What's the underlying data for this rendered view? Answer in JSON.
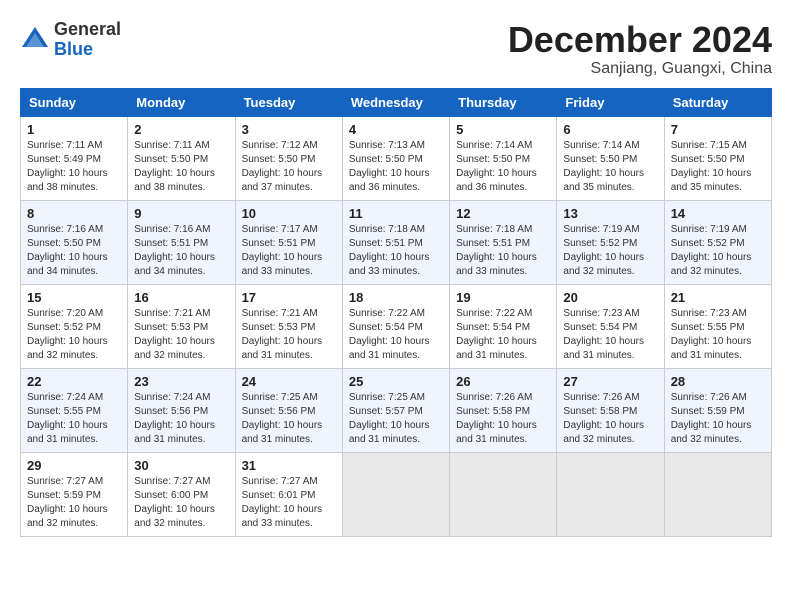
{
  "header": {
    "logo_general": "General",
    "logo_blue": "Blue",
    "month_year": "December 2024",
    "location": "Sanjiang, Guangxi, China"
  },
  "days_of_week": [
    "Sunday",
    "Monday",
    "Tuesday",
    "Wednesday",
    "Thursday",
    "Friday",
    "Saturday"
  ],
  "weeks": [
    [
      {
        "day": "1",
        "detail": "Sunrise: 7:11 AM\nSunset: 5:49 PM\nDaylight: 10 hours\nand 38 minutes."
      },
      {
        "day": "2",
        "detail": "Sunrise: 7:11 AM\nSunset: 5:50 PM\nDaylight: 10 hours\nand 38 minutes."
      },
      {
        "day": "3",
        "detail": "Sunrise: 7:12 AM\nSunset: 5:50 PM\nDaylight: 10 hours\nand 37 minutes."
      },
      {
        "day": "4",
        "detail": "Sunrise: 7:13 AM\nSunset: 5:50 PM\nDaylight: 10 hours\nand 36 minutes."
      },
      {
        "day": "5",
        "detail": "Sunrise: 7:14 AM\nSunset: 5:50 PM\nDaylight: 10 hours\nand 36 minutes."
      },
      {
        "day": "6",
        "detail": "Sunrise: 7:14 AM\nSunset: 5:50 PM\nDaylight: 10 hours\nand 35 minutes."
      },
      {
        "day": "7",
        "detail": "Sunrise: 7:15 AM\nSunset: 5:50 PM\nDaylight: 10 hours\nand 35 minutes."
      }
    ],
    [
      {
        "day": "8",
        "detail": "Sunrise: 7:16 AM\nSunset: 5:50 PM\nDaylight: 10 hours\nand 34 minutes."
      },
      {
        "day": "9",
        "detail": "Sunrise: 7:16 AM\nSunset: 5:51 PM\nDaylight: 10 hours\nand 34 minutes."
      },
      {
        "day": "10",
        "detail": "Sunrise: 7:17 AM\nSunset: 5:51 PM\nDaylight: 10 hours\nand 33 minutes."
      },
      {
        "day": "11",
        "detail": "Sunrise: 7:18 AM\nSunset: 5:51 PM\nDaylight: 10 hours\nand 33 minutes."
      },
      {
        "day": "12",
        "detail": "Sunrise: 7:18 AM\nSunset: 5:51 PM\nDaylight: 10 hours\nand 33 minutes."
      },
      {
        "day": "13",
        "detail": "Sunrise: 7:19 AM\nSunset: 5:52 PM\nDaylight: 10 hours\nand 32 minutes."
      },
      {
        "day": "14",
        "detail": "Sunrise: 7:19 AM\nSunset: 5:52 PM\nDaylight: 10 hours\nand 32 minutes."
      }
    ],
    [
      {
        "day": "15",
        "detail": "Sunrise: 7:20 AM\nSunset: 5:52 PM\nDaylight: 10 hours\nand 32 minutes."
      },
      {
        "day": "16",
        "detail": "Sunrise: 7:21 AM\nSunset: 5:53 PM\nDaylight: 10 hours\nand 32 minutes."
      },
      {
        "day": "17",
        "detail": "Sunrise: 7:21 AM\nSunset: 5:53 PM\nDaylight: 10 hours\nand 31 minutes."
      },
      {
        "day": "18",
        "detail": "Sunrise: 7:22 AM\nSunset: 5:54 PM\nDaylight: 10 hours\nand 31 minutes."
      },
      {
        "day": "19",
        "detail": "Sunrise: 7:22 AM\nSunset: 5:54 PM\nDaylight: 10 hours\nand 31 minutes."
      },
      {
        "day": "20",
        "detail": "Sunrise: 7:23 AM\nSunset: 5:54 PM\nDaylight: 10 hours\nand 31 minutes."
      },
      {
        "day": "21",
        "detail": "Sunrise: 7:23 AM\nSunset: 5:55 PM\nDaylight: 10 hours\nand 31 minutes."
      }
    ],
    [
      {
        "day": "22",
        "detail": "Sunrise: 7:24 AM\nSunset: 5:55 PM\nDaylight: 10 hours\nand 31 minutes."
      },
      {
        "day": "23",
        "detail": "Sunrise: 7:24 AM\nSunset: 5:56 PM\nDaylight: 10 hours\nand 31 minutes."
      },
      {
        "day": "24",
        "detail": "Sunrise: 7:25 AM\nSunset: 5:56 PM\nDaylight: 10 hours\nand 31 minutes."
      },
      {
        "day": "25",
        "detail": "Sunrise: 7:25 AM\nSunset: 5:57 PM\nDaylight: 10 hours\nand 31 minutes."
      },
      {
        "day": "26",
        "detail": "Sunrise: 7:26 AM\nSunset: 5:58 PM\nDaylight: 10 hours\nand 31 minutes."
      },
      {
        "day": "27",
        "detail": "Sunrise: 7:26 AM\nSunset: 5:58 PM\nDaylight: 10 hours\nand 32 minutes."
      },
      {
        "day": "28",
        "detail": "Sunrise: 7:26 AM\nSunset: 5:59 PM\nDaylight: 10 hours\nand 32 minutes."
      }
    ],
    [
      {
        "day": "29",
        "detail": "Sunrise: 7:27 AM\nSunset: 5:59 PM\nDaylight: 10 hours\nand 32 minutes."
      },
      {
        "day": "30",
        "detail": "Sunrise: 7:27 AM\nSunset: 6:00 PM\nDaylight: 10 hours\nand 32 minutes."
      },
      {
        "day": "31",
        "detail": "Sunrise: 7:27 AM\nSunset: 6:01 PM\nDaylight: 10 hours\nand 33 minutes."
      },
      null,
      null,
      null,
      null
    ]
  ]
}
